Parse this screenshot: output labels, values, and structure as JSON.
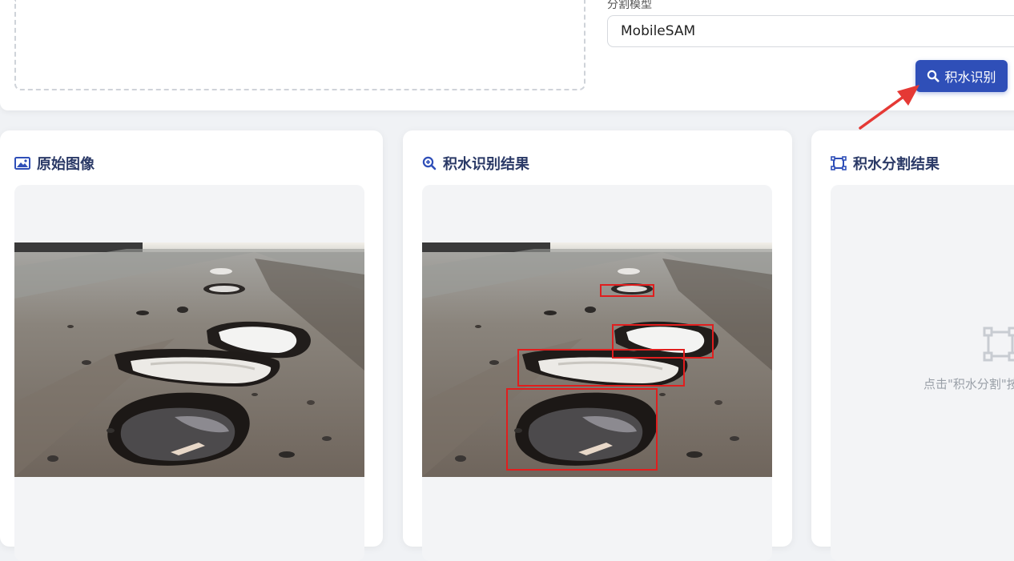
{
  "model": {
    "label": "分割模型",
    "selected": "MobileSAM"
  },
  "actions": {
    "detect_label": "积水识别"
  },
  "panels": [
    {
      "title": "原始图像",
      "icon": "image-icon"
    },
    {
      "title": "积水识别结果",
      "icon": "zoom-search-icon"
    },
    {
      "title": "积水分割结果",
      "icon": "segment-frame-icon",
      "placeholder": "点击\"积水分割\"按"
    }
  ],
  "colors": {
    "accent": "#2f4fb8",
    "title": "#2b3a67",
    "box_outline": "#e01e1e",
    "arrow": "#e53935"
  }
}
